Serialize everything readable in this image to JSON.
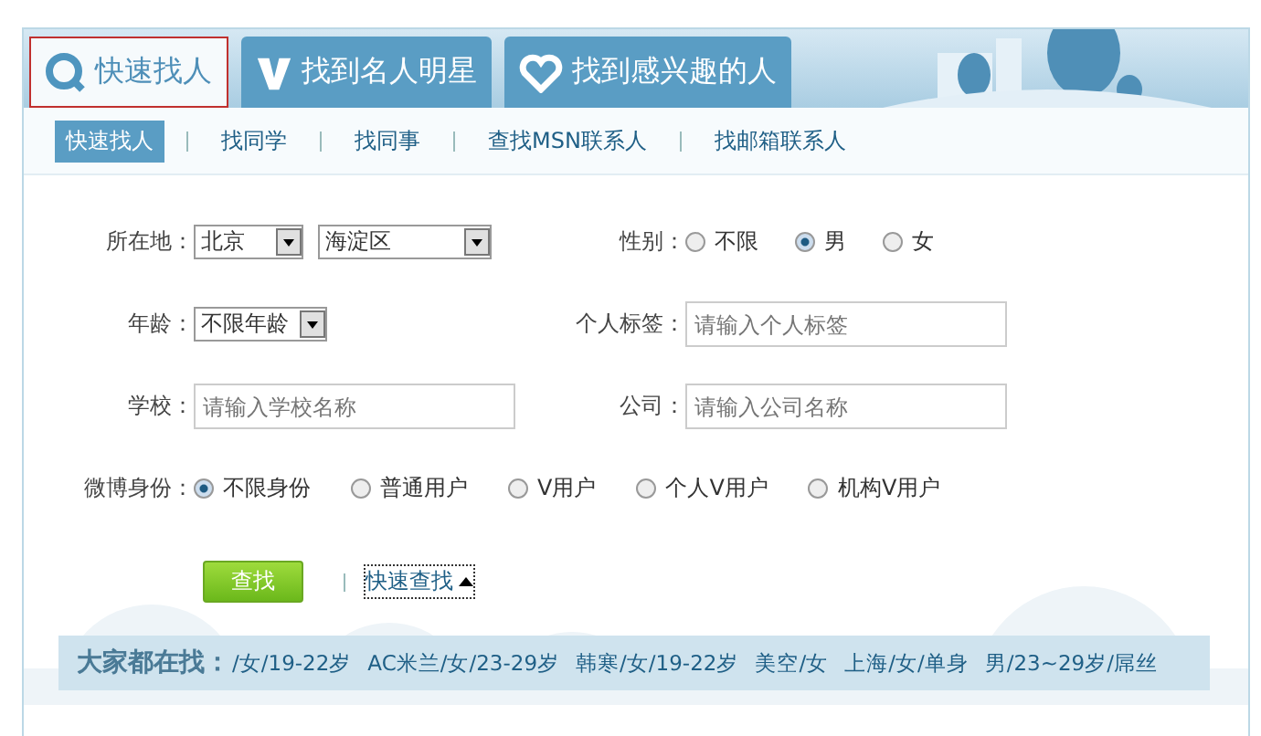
{
  "tabs": [
    {
      "label": "快速找人",
      "selected": true,
      "kind": "search"
    },
    {
      "label": "找到名人明星",
      "selected": false,
      "kind": "v"
    },
    {
      "label": "找到感兴趣的人",
      "selected": false,
      "kind": "heart"
    }
  ],
  "subnav": [
    {
      "label": "快速找人",
      "selected": true
    },
    {
      "label": "找同学",
      "selected": false
    },
    {
      "label": "找同事",
      "selected": false
    },
    {
      "label": "查找MSN联系人",
      "selected": false
    },
    {
      "label": "找邮箱联系人",
      "selected": false
    }
  ],
  "location": {
    "label": "所在地：",
    "province": "北京",
    "district": "海淀区"
  },
  "gender": {
    "label": "性别：",
    "options": [
      {
        "label": "不限",
        "selected": false
      },
      {
        "label": "男",
        "selected": true
      },
      {
        "label": "女",
        "selected": false
      }
    ]
  },
  "age": {
    "label": "年龄：",
    "value": "不限年龄"
  },
  "tag": {
    "label": "个人标签：",
    "placeholder": "请输入个人标签"
  },
  "school": {
    "label": "学校：",
    "placeholder": "请输入学校名称"
  },
  "company": {
    "label": "公司：",
    "placeholder": "请输入公司名称"
  },
  "identity": {
    "label": "微博身份：",
    "options": [
      {
        "label": "不限身份",
        "selected": true
      },
      {
        "label": "普通用户",
        "selected": false
      },
      {
        "label": "V用户",
        "selected": false
      },
      {
        "label": "个人V用户",
        "selected": false
      },
      {
        "label": "机构V用户",
        "selected": false
      }
    ]
  },
  "search_button": "查找",
  "toggle_link": "快速查找",
  "trending": {
    "heading": "大家都在找：",
    "items": [
      "/女/19-22岁",
      "AC米兰/女/23-29岁",
      "韩寒/女/19-22岁",
      "美空/女",
      "上海/女/单身",
      "男/23~29岁/屌丝"
    ]
  }
}
